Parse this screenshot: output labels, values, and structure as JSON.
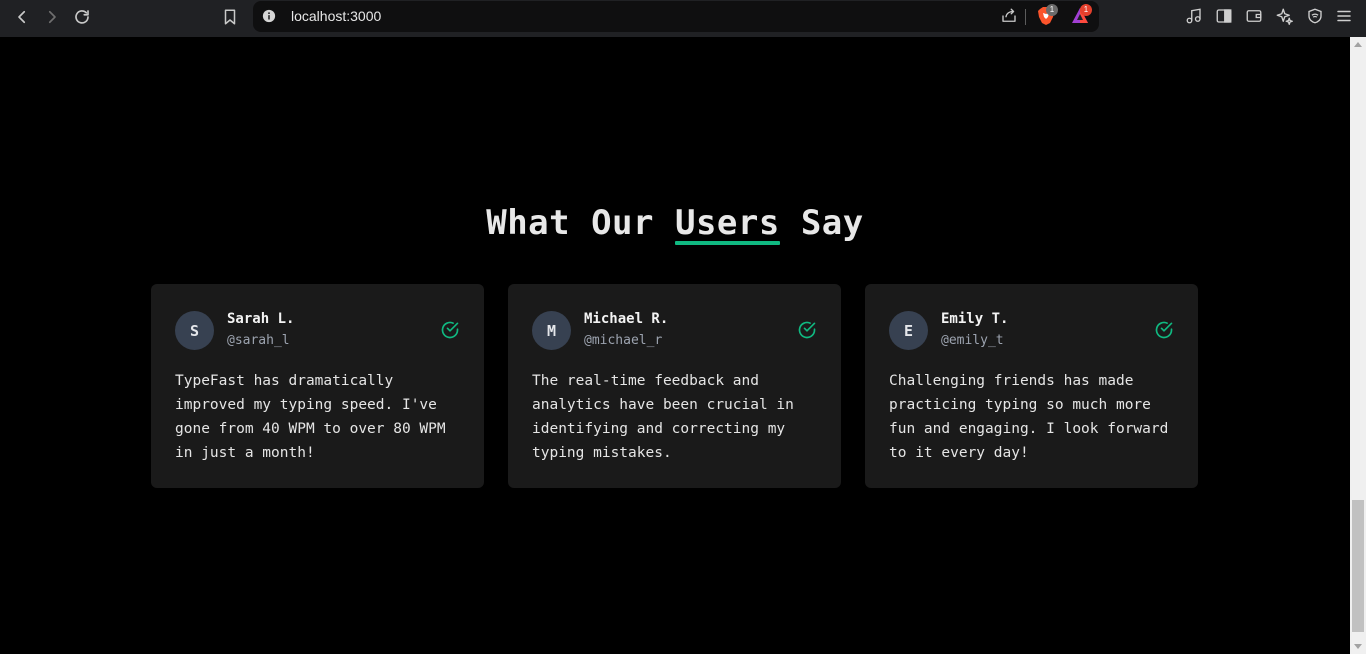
{
  "browser": {
    "url": "localhost:3000",
    "brave_badge": "1",
    "rewards_badge": "1",
    "icons": [
      "back-icon",
      "forward-icon",
      "reload-icon",
      "bookmark-icon",
      "info-icon",
      "share-icon",
      "brave-shields-icon",
      "brave-rewards-icon",
      "media-icon",
      "sidebar-icon",
      "wallet-icon",
      "leo-ai-icon",
      "vpn-icon",
      "menu-icon"
    ]
  },
  "section": {
    "title_before": "What Our",
    "title_highlight": "Users",
    "title_after": "Say",
    "accent_color": "#10b981"
  },
  "testimonials": [
    {
      "initial": "S",
      "name": "Sarah L.",
      "handle": "@sarah_l",
      "quote": "TypeFast has dramatically improved my typing speed. I've gone from 40 WPM to over 80 WPM in just a month!"
    },
    {
      "initial": "M",
      "name": "Michael R.",
      "handle": "@michael_r",
      "quote": "The real-time feedback and analytics have been crucial in identifying and correcting my typing mistakes."
    },
    {
      "initial": "E",
      "name": "Emily T.",
      "handle": "@emily_t",
      "quote": "Challenging friends has made practicing typing so much more fun and engaging. I look forward to it every day!"
    }
  ]
}
